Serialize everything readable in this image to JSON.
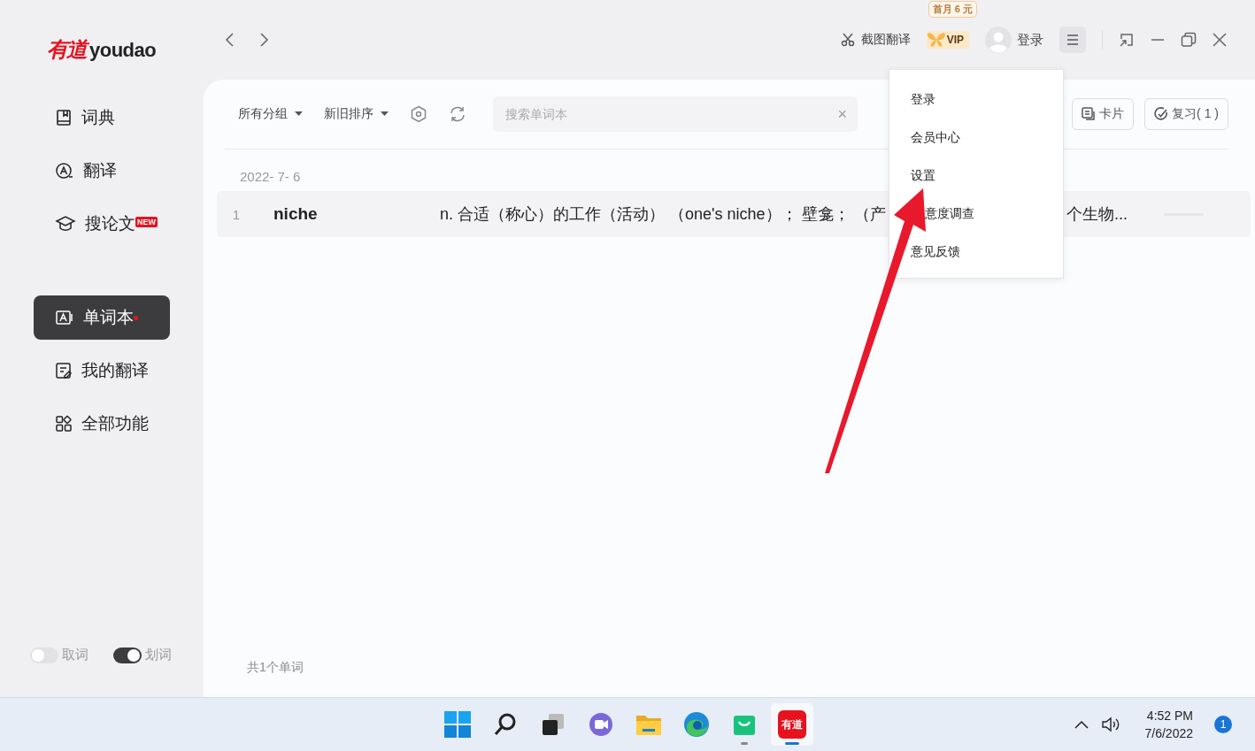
{
  "logo": {
    "mark": "有道",
    "word": "youdao"
  },
  "sidebar": {
    "items": [
      {
        "kind": "dict",
        "label": "词典",
        "selected": false,
        "dot": false
      },
      {
        "kind": "translate",
        "label": "翻译",
        "selected": false,
        "dot": false
      },
      {
        "kind": "paper",
        "label": "搜论文",
        "selected": false,
        "badge": "NEW",
        "dot": false
      },
      {
        "kind": "wordbook",
        "label": "单词本",
        "selected": true,
        "dot": true
      },
      {
        "kind": "mytrans",
        "label": "我的翻译",
        "selected": false,
        "dot": false
      },
      {
        "kind": "apps",
        "label": "全部功能",
        "selected": false,
        "dot": false
      }
    ],
    "toggles": [
      {
        "label": "取词",
        "on": false
      },
      {
        "label": "划词",
        "on": true
      }
    ]
  },
  "topbar": {
    "screenshot_label": "截图翻译",
    "vip_label": "VIP",
    "vip_tip": "首月 6 元",
    "login_label": "登录",
    "menu_open": true
  },
  "toolbar": {
    "group_filter": "所有分组",
    "sort": "新旧排序",
    "search": {
      "placeholder": "搜索单词本",
      "clear": "×"
    },
    "card_button": "卡片",
    "review_button": "复习( 1 )"
  },
  "word_list": {
    "date": "2022- 7- 6",
    "rows": [
      {
        "index": "1",
        "word": "niche",
        "meaning_visible_start": "n. 合适（称心）的工作（活动） （one's niche）； 壁龛； （产",
        "meaning_visible_end": "个生物..."
      }
    ]
  },
  "footer": {
    "count": "共1个单词"
  },
  "menu": {
    "items": [
      "登录",
      "会员中心",
      "设置",
      "意度调查",
      "意见反馈"
    ]
  },
  "annotation": {
    "kind": "arrow"
  },
  "taskbar": {
    "apps": [
      {
        "kind": "start",
        "running": false,
        "selected": false
      },
      {
        "kind": "search",
        "running": false,
        "selected": false
      },
      {
        "kind": "taskview",
        "running": false,
        "selected": false
      },
      {
        "kind": "chat",
        "running": false,
        "selected": false
      },
      {
        "kind": "explorer",
        "running": false,
        "selected": false
      },
      {
        "kind": "edge",
        "running": false,
        "selected": false
      },
      {
        "kind": "store",
        "running": true,
        "selected": false
      },
      {
        "kind": "youdao",
        "label": "有道",
        "running": true,
        "selected": true
      }
    ],
    "time": "4:52 PM",
    "date": "7/6/2022",
    "notifications": "1"
  }
}
